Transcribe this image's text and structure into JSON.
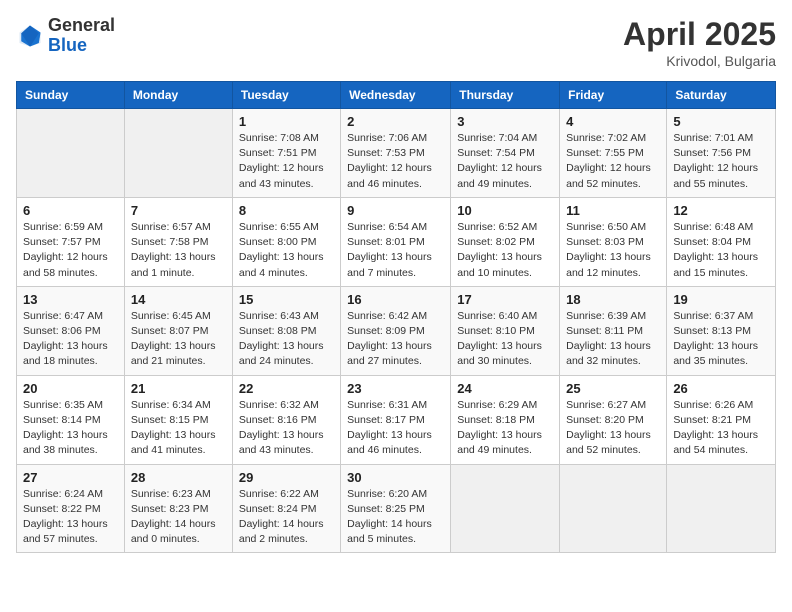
{
  "header": {
    "logo_general": "General",
    "logo_blue": "Blue",
    "title": "April 2025",
    "location": "Krivodol, Bulgaria"
  },
  "weekdays": [
    "Sunday",
    "Monday",
    "Tuesday",
    "Wednesday",
    "Thursday",
    "Friday",
    "Saturday"
  ],
  "weeks": [
    [
      {
        "day": "",
        "info": ""
      },
      {
        "day": "",
        "info": ""
      },
      {
        "day": "1",
        "info": "Sunrise: 7:08 AM\nSunset: 7:51 PM\nDaylight: 12 hours\nand 43 minutes."
      },
      {
        "day": "2",
        "info": "Sunrise: 7:06 AM\nSunset: 7:53 PM\nDaylight: 12 hours\nand 46 minutes."
      },
      {
        "day": "3",
        "info": "Sunrise: 7:04 AM\nSunset: 7:54 PM\nDaylight: 12 hours\nand 49 minutes."
      },
      {
        "day": "4",
        "info": "Sunrise: 7:02 AM\nSunset: 7:55 PM\nDaylight: 12 hours\nand 52 minutes."
      },
      {
        "day": "5",
        "info": "Sunrise: 7:01 AM\nSunset: 7:56 PM\nDaylight: 12 hours\nand 55 minutes."
      }
    ],
    [
      {
        "day": "6",
        "info": "Sunrise: 6:59 AM\nSunset: 7:57 PM\nDaylight: 12 hours\nand 58 minutes."
      },
      {
        "day": "7",
        "info": "Sunrise: 6:57 AM\nSunset: 7:58 PM\nDaylight: 13 hours\nand 1 minute."
      },
      {
        "day": "8",
        "info": "Sunrise: 6:55 AM\nSunset: 8:00 PM\nDaylight: 13 hours\nand 4 minutes."
      },
      {
        "day": "9",
        "info": "Sunrise: 6:54 AM\nSunset: 8:01 PM\nDaylight: 13 hours\nand 7 minutes."
      },
      {
        "day": "10",
        "info": "Sunrise: 6:52 AM\nSunset: 8:02 PM\nDaylight: 13 hours\nand 10 minutes."
      },
      {
        "day": "11",
        "info": "Sunrise: 6:50 AM\nSunset: 8:03 PM\nDaylight: 13 hours\nand 12 minutes."
      },
      {
        "day": "12",
        "info": "Sunrise: 6:48 AM\nSunset: 8:04 PM\nDaylight: 13 hours\nand 15 minutes."
      }
    ],
    [
      {
        "day": "13",
        "info": "Sunrise: 6:47 AM\nSunset: 8:06 PM\nDaylight: 13 hours\nand 18 minutes."
      },
      {
        "day": "14",
        "info": "Sunrise: 6:45 AM\nSunset: 8:07 PM\nDaylight: 13 hours\nand 21 minutes."
      },
      {
        "day": "15",
        "info": "Sunrise: 6:43 AM\nSunset: 8:08 PM\nDaylight: 13 hours\nand 24 minutes."
      },
      {
        "day": "16",
        "info": "Sunrise: 6:42 AM\nSunset: 8:09 PM\nDaylight: 13 hours\nand 27 minutes."
      },
      {
        "day": "17",
        "info": "Sunrise: 6:40 AM\nSunset: 8:10 PM\nDaylight: 13 hours\nand 30 minutes."
      },
      {
        "day": "18",
        "info": "Sunrise: 6:39 AM\nSunset: 8:11 PM\nDaylight: 13 hours\nand 32 minutes."
      },
      {
        "day": "19",
        "info": "Sunrise: 6:37 AM\nSunset: 8:13 PM\nDaylight: 13 hours\nand 35 minutes."
      }
    ],
    [
      {
        "day": "20",
        "info": "Sunrise: 6:35 AM\nSunset: 8:14 PM\nDaylight: 13 hours\nand 38 minutes."
      },
      {
        "day": "21",
        "info": "Sunrise: 6:34 AM\nSunset: 8:15 PM\nDaylight: 13 hours\nand 41 minutes."
      },
      {
        "day": "22",
        "info": "Sunrise: 6:32 AM\nSunset: 8:16 PM\nDaylight: 13 hours\nand 43 minutes."
      },
      {
        "day": "23",
        "info": "Sunrise: 6:31 AM\nSunset: 8:17 PM\nDaylight: 13 hours\nand 46 minutes."
      },
      {
        "day": "24",
        "info": "Sunrise: 6:29 AM\nSunset: 8:18 PM\nDaylight: 13 hours\nand 49 minutes."
      },
      {
        "day": "25",
        "info": "Sunrise: 6:27 AM\nSunset: 8:20 PM\nDaylight: 13 hours\nand 52 minutes."
      },
      {
        "day": "26",
        "info": "Sunrise: 6:26 AM\nSunset: 8:21 PM\nDaylight: 13 hours\nand 54 minutes."
      }
    ],
    [
      {
        "day": "27",
        "info": "Sunrise: 6:24 AM\nSunset: 8:22 PM\nDaylight: 13 hours\nand 57 minutes."
      },
      {
        "day": "28",
        "info": "Sunrise: 6:23 AM\nSunset: 8:23 PM\nDaylight: 14 hours\nand 0 minutes."
      },
      {
        "day": "29",
        "info": "Sunrise: 6:22 AM\nSunset: 8:24 PM\nDaylight: 14 hours\nand 2 minutes."
      },
      {
        "day": "30",
        "info": "Sunrise: 6:20 AM\nSunset: 8:25 PM\nDaylight: 14 hours\nand 5 minutes."
      },
      {
        "day": "",
        "info": ""
      },
      {
        "day": "",
        "info": ""
      },
      {
        "day": "",
        "info": ""
      }
    ]
  ]
}
